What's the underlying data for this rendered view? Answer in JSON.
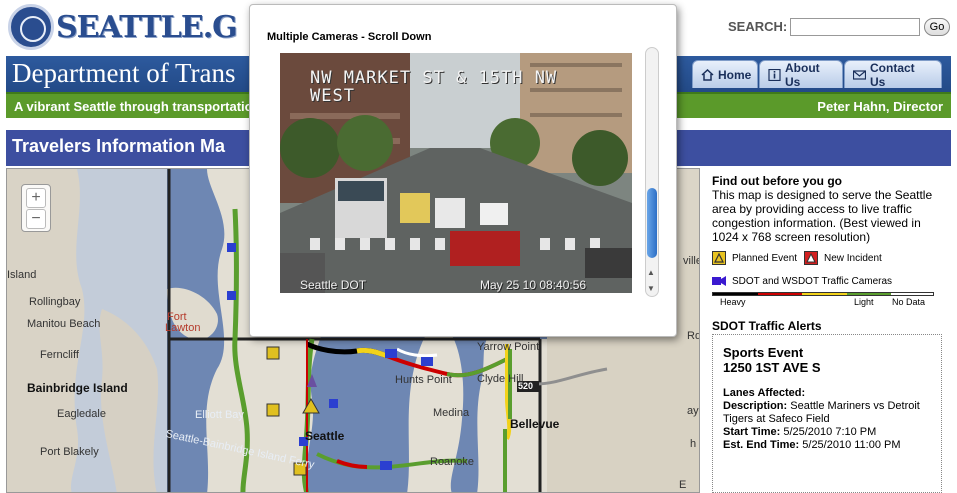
{
  "header": {
    "logo_text": "SEATTLE.G",
    "search_label": "SEARCH:",
    "search_value": "",
    "go_label": "Go"
  },
  "dept": {
    "title": "Department of Trans",
    "tabs": [
      {
        "label": "Home",
        "icon": "home-icon"
      },
      {
        "label": "About Us",
        "icon": "info-icon"
      },
      {
        "label": "Contact Us",
        "icon": "mail-icon"
      }
    ]
  },
  "tagbar": {
    "tagline": "A vibrant Seattle through transportatio",
    "director": "Peter Hahn, Director"
  },
  "travelers": {
    "title": "Travelers Information Ma"
  },
  "map": {
    "zoom_in": "+",
    "zoom_out": "−",
    "labels": {
      "island": "Island",
      "rollingbay": "Rollingbay",
      "manitou": "Manitou Beach",
      "fort_lawton_1": "Fort",
      "fort_lawton_2": "Lawton",
      "ferncliff": "Ferncliff",
      "bainbridge": "Bainbridge Island",
      "eagledale": "Eagledale",
      "elliott": "Elliott Bay",
      "ferry": "Seattle-Bainbridge Island Ferry",
      "port_blakely": "Port Blakely",
      "seattle": "Seattle",
      "medina": "Medina",
      "hunts_point": "Hunts Point",
      "clyde_hill": "Clyde Hill",
      "yarrow_point": "Yarrow Point",
      "bellevue": "Bellevue",
      "roanoke": "Roanoke",
      "hwy_520": "520",
      "kirkland": "ville",
      "rd": "Rd",
      "ay": "ay",
      "rd_s": "h",
      "e_hill": "E"
    }
  },
  "sidebar": {
    "find_title": "Find out before you go",
    "find_desc": "This map is designed to serve the Seattle area by providing access to live traffic congestion information. (Best viewed in 1024 x 768 screen resolution)",
    "legend": {
      "planned": "Planned Event",
      "incident": "New Incident",
      "cameras": "SDOT and WSDOT Traffic Cameras"
    },
    "traffic_scale": {
      "heavy": "Heavy",
      "light": "Light",
      "no_data": "No Data"
    },
    "alerts_title": "SDOT Traffic Alerts",
    "alert": {
      "event": "Sports Event",
      "address": "1250 1ST AVE S",
      "lanes_label": "Lanes Affected:",
      "desc_label": "Description:",
      "desc_value": "Seattle Mariners vs Detroit Tigers at Safeco Field",
      "start_label": "Start Time:",
      "start_value": "5/25/2010 7:10 PM",
      "end_label": "Est. End Time:",
      "end_value": "5/25/2010 11:00 PM"
    }
  },
  "camera_popup": {
    "title": "Multiple Cameras - Scroll Down",
    "street": "NW MARKET ST & 15TH NW WEST",
    "credit": "Seattle DOT",
    "timestamp": "May 25 10 08:40:56"
  },
  "colors": {
    "brand_blue": "#2a4d8f",
    "dept_blue": "#2d5a9e",
    "tag_green": "#5b9a2a",
    "travelers_bar": "#3d4fa0",
    "traffic_heavy": "#000000",
    "traffic_red": "#cc0000",
    "traffic_yellow": "#f2d21a",
    "traffic_green": "#5a9e2e"
  }
}
